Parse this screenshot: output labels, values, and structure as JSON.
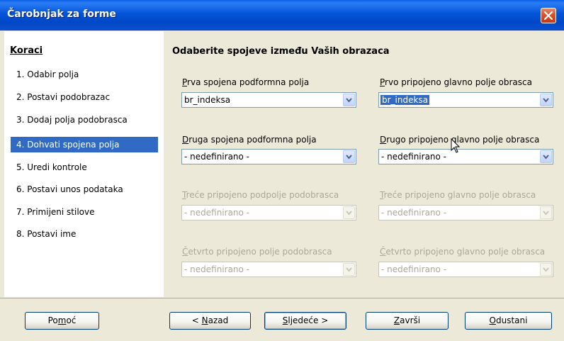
{
  "window": {
    "title": "Čarobnjak za forme"
  },
  "steps": {
    "header": "Koraci",
    "items": [
      {
        "label": "1. Odabir polja"
      },
      {
        "label": "2. Postavi podobrazac"
      },
      {
        "label": "3. Dodaj polja podobrasca"
      },
      {
        "label": "4. Dohvati spojena polja"
      },
      {
        "label": "5. Uredi kontrole"
      },
      {
        "label": "6. Postavi unos podataka"
      },
      {
        "label": "7. Primijeni stilove"
      },
      {
        "label": "8. Postavi ime"
      }
    ],
    "selected": "4. Dohvati spojena polja"
  },
  "main": {
    "heading": "Odaberite spojeve između Vaših obrazaca",
    "fields": [
      {
        "label_ul": "P",
        "label_rest": "rva spojena podformna polja",
        "value": "br_indeksa",
        "enabled": true
      },
      {
        "label_ul": "P",
        "label_rest": "rvo pripojeno glavno polje obrasca",
        "value": "br_indeksa",
        "enabled": true,
        "focused": true
      },
      {
        "label_ul": "D",
        "label_rest": "ruga spojena podformna polja",
        "value": "- nedefinirano -",
        "enabled": true
      },
      {
        "label_ul": "D",
        "label_rest": "rugo pripojeno glavno polje obrasca",
        "value": "- nedefinirano -",
        "enabled": true
      },
      {
        "label_ul": "T",
        "label_rest": "reće pripojeno podpolje podobrasca",
        "value": "- nedefinirano -",
        "enabled": false
      },
      {
        "label_ul": "T",
        "label_rest": "reće pripojeno glavno polje obrasca",
        "value": "- nedefinirano -",
        "enabled": false
      },
      {
        "label_ul": "Č",
        "label_rest": "etvrto pripojeno polje podobrasca",
        "value": "- nedefinirano -",
        "enabled": false
      },
      {
        "label_ul": "Č",
        "label_rest": "etvrto pripojeno glavno polje obrasca",
        "value": "- nedefinirano -",
        "enabled": false
      }
    ]
  },
  "buttons": {
    "help": {
      "pre": "Po",
      "ul": "m",
      "post": "oć"
    },
    "back": {
      "pre": "< ",
      "ul": "N",
      "post": "azad"
    },
    "next": {
      "pre": "",
      "ul": "S",
      "post": "ljedeće >"
    },
    "finish": {
      "pre": "",
      "ul": "Z",
      "post": "avrši"
    },
    "cancel": {
      "pre": "",
      "ul": "O",
      "post": "dustani"
    }
  },
  "colors": {
    "titlebar": "#0454d9",
    "selection": "#316ac5",
    "dialog_bg": "#ece9d8",
    "disabled_text": "#aca899"
  },
  "icons": [
    "close-icon",
    "dropdown-arrow-icon",
    "mouse-pointer-icon"
  ]
}
